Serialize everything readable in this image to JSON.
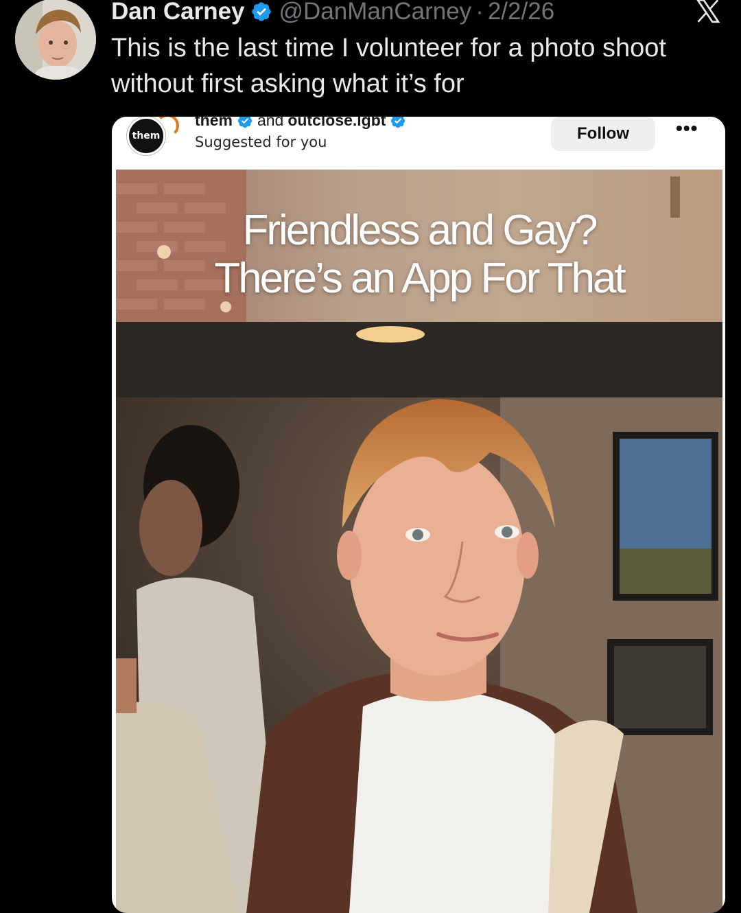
{
  "tweet": {
    "author_name": "Dan Carney",
    "handle": "@DanManCarney",
    "separator": "·",
    "date": "2/2/26",
    "text": "This is the last time I volunteer for a photo shoot without first asking what it’s for"
  },
  "embedded_post": {
    "brand_logo_text": "them",
    "account_primary": "them",
    "account_conjunction": "and",
    "account_secondary": "outclose.lgbt",
    "subtitle": "Suggested for you",
    "follow_label": "Follow",
    "more_label": "•••",
    "headline_line1": "Friendless and Gay?",
    "headline_line2": "There’s an App For That"
  },
  "colors": {
    "verified_blue": "#1d9bf0",
    "background": "#000000",
    "text_primary": "#e7e9ea",
    "text_secondary": "#71767b"
  },
  "icons": {
    "verified": "verified-badge-icon",
    "platform": "x-logo-icon",
    "more": "more-options-icon"
  }
}
